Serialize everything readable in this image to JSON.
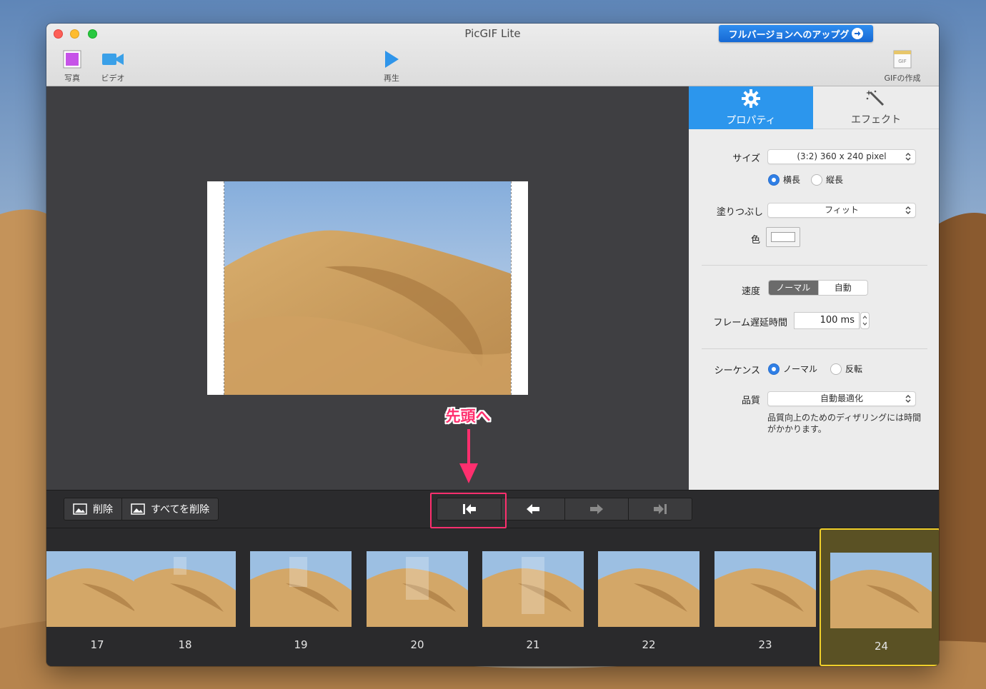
{
  "window": {
    "title": "PicGIF Lite",
    "upgrade_label": "フルバージョンへのアップグ"
  },
  "toolbar": {
    "photo_label": "写真",
    "video_label": "ビデオ",
    "play_label": "再生",
    "gif_label": "GIFの作成",
    "gif_icon_text": "GIF"
  },
  "tabs": {
    "properties_label": "プロパティ",
    "effects_label": "エフェクト"
  },
  "properties": {
    "size_label": "サイズ",
    "size_value": "(3:2) 360 x 240 pixel",
    "orientation_landscape": "横長",
    "orientation_portrait": "縦長",
    "fill_label": "塗りつぶし",
    "fill_value": "フィット",
    "color_label": "色",
    "color_value": "#ffffff",
    "speed_label": "速度",
    "speed_normal": "ノーマル",
    "speed_auto": "自動",
    "delay_label": "フレーム遅延時間",
    "delay_value": "100 ms",
    "sequence_label": "シーケンス",
    "sequence_normal": "ノーマル",
    "sequence_reverse": "反転",
    "quality_label": "品質",
    "quality_value": "自動最適化",
    "quality_note": "品質向上のためのディザリングには時間がかかります。"
  },
  "controls": {
    "delete_label": "削除",
    "delete_all_label": "すべてを削除"
  },
  "annotation": {
    "label": "先頭へ",
    "color": "#ff2f6e"
  },
  "frames": [
    {
      "number": "17"
    },
    {
      "number": "18"
    },
    {
      "number": "19"
    },
    {
      "number": "20"
    },
    {
      "number": "21"
    },
    {
      "number": "22"
    },
    {
      "number": "23"
    },
    {
      "number": "24"
    }
  ],
  "selected_frame": "24",
  "colors": {
    "accent": "#2c96ed",
    "selection": "#f0cf2b"
  }
}
